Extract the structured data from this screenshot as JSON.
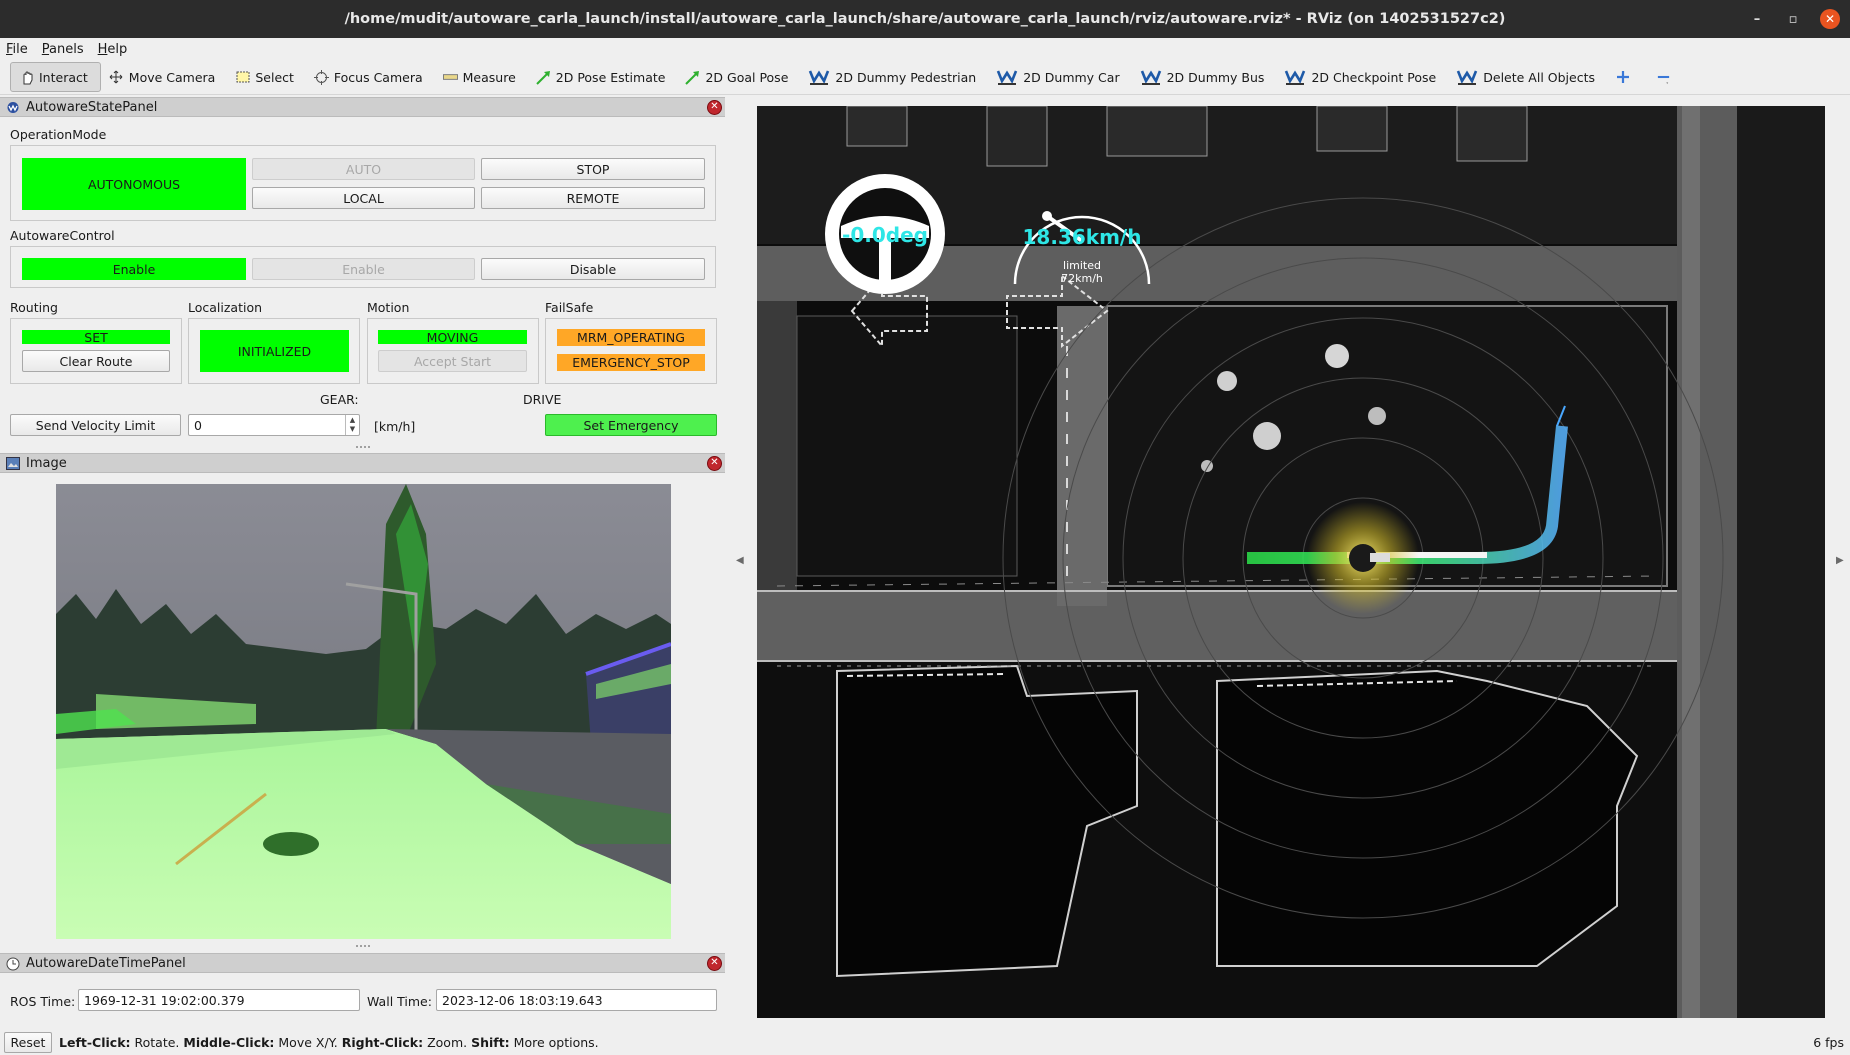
{
  "window": {
    "title": "/home/mudit/autoware_carla_launch/install/autoware_carla_launch/share/autoware_carla_launch/rviz/autoware.rviz* - RViz (on 1402531527c2)",
    "minimize": "–",
    "maximize": "▫",
    "close": "✕"
  },
  "menu": [
    "File",
    "Panels",
    "Help"
  ],
  "toolbar": [
    {
      "label": "Interact",
      "icon": "hand-pointer-icon"
    },
    {
      "label": "Move Camera",
      "icon": "move-camera-icon"
    },
    {
      "label": "Select",
      "icon": "select-box-icon"
    },
    {
      "label": "Focus Camera",
      "icon": "focus-target-icon"
    },
    {
      "label": "Measure",
      "icon": "ruler-icon"
    },
    {
      "label": "2D Pose Estimate",
      "icon": "green-arrow-icon"
    },
    {
      "label": "2D Goal Pose",
      "icon": "green-arrow-icon"
    },
    {
      "label": "2D Dummy Pedestrian",
      "icon": "autoware-logo-icon"
    },
    {
      "label": "2D Dummy Car",
      "icon": "autoware-logo-icon"
    },
    {
      "label": "2D Dummy Bus",
      "icon": "autoware-logo-icon"
    },
    {
      "label": "2D Checkpoint Pose",
      "icon": "autoware-logo-icon"
    },
    {
      "label": "Delete All Objects",
      "icon": "autoware-logo-icon"
    }
  ],
  "state_panel": {
    "title": "AutowareStatePanel",
    "operation_mode": {
      "label": "OperationMode",
      "status": "AUTONOMOUS",
      "auto": "AUTO",
      "stop": "STOP",
      "local": "LOCAL",
      "remote": "REMOTE"
    },
    "autoware_control": {
      "label": "AutowareControl",
      "enable_status": "Enable",
      "enable_button": "Enable",
      "disable_button": "Disable"
    },
    "routing": {
      "label": "Routing",
      "status": "SET",
      "button": "Clear Route"
    },
    "localization": {
      "label": "Localization",
      "status": "INITIALIZED"
    },
    "motion": {
      "label": "Motion",
      "status": "MOVING",
      "button": "Accept Start"
    },
    "failsafe": {
      "label": "FailSafe",
      "status1": "MRM_OPERATING",
      "status2": "EMERGENCY_STOP"
    },
    "gear_label": "GEAR:",
    "gear_value": "DRIVE",
    "velocity": {
      "button": "Send Velocity Limit",
      "value": "0",
      "unit": "[km/h]"
    },
    "emergency_button": "Set Emergency"
  },
  "image_panel": {
    "title": "Image"
  },
  "datetime_panel": {
    "title": "AutowareDateTimePanel",
    "ros_label": "ROS Time:",
    "ros_value": "1969-12-31 19:02:00.379",
    "wall_label": "Wall Time:",
    "wall_value": "2023-12-06 18:03:19.643"
  },
  "viewport": {
    "steering": "-0.0deg",
    "speed": "18.36km/h",
    "limit_text": "limited",
    "limit_value": "72km/h"
  },
  "statusbar": {
    "reset": "Reset",
    "hint_b1": "Left-Click:",
    "hint_t1": " Rotate. ",
    "hint_b2": "Middle-Click:",
    "hint_t2": " Move X/Y. ",
    "hint_b3": "Right-Click:",
    "hint_t3": " Zoom. ",
    "hint_b4": "Shift:",
    "hint_t4": " More options.",
    "fps": "6 fps"
  },
  "colors": {
    "status_green": "#00ff00",
    "status_orange": "#ffa726",
    "speed_cyan": "#2ee6e6",
    "titlebar": "#2c2c2c"
  }
}
